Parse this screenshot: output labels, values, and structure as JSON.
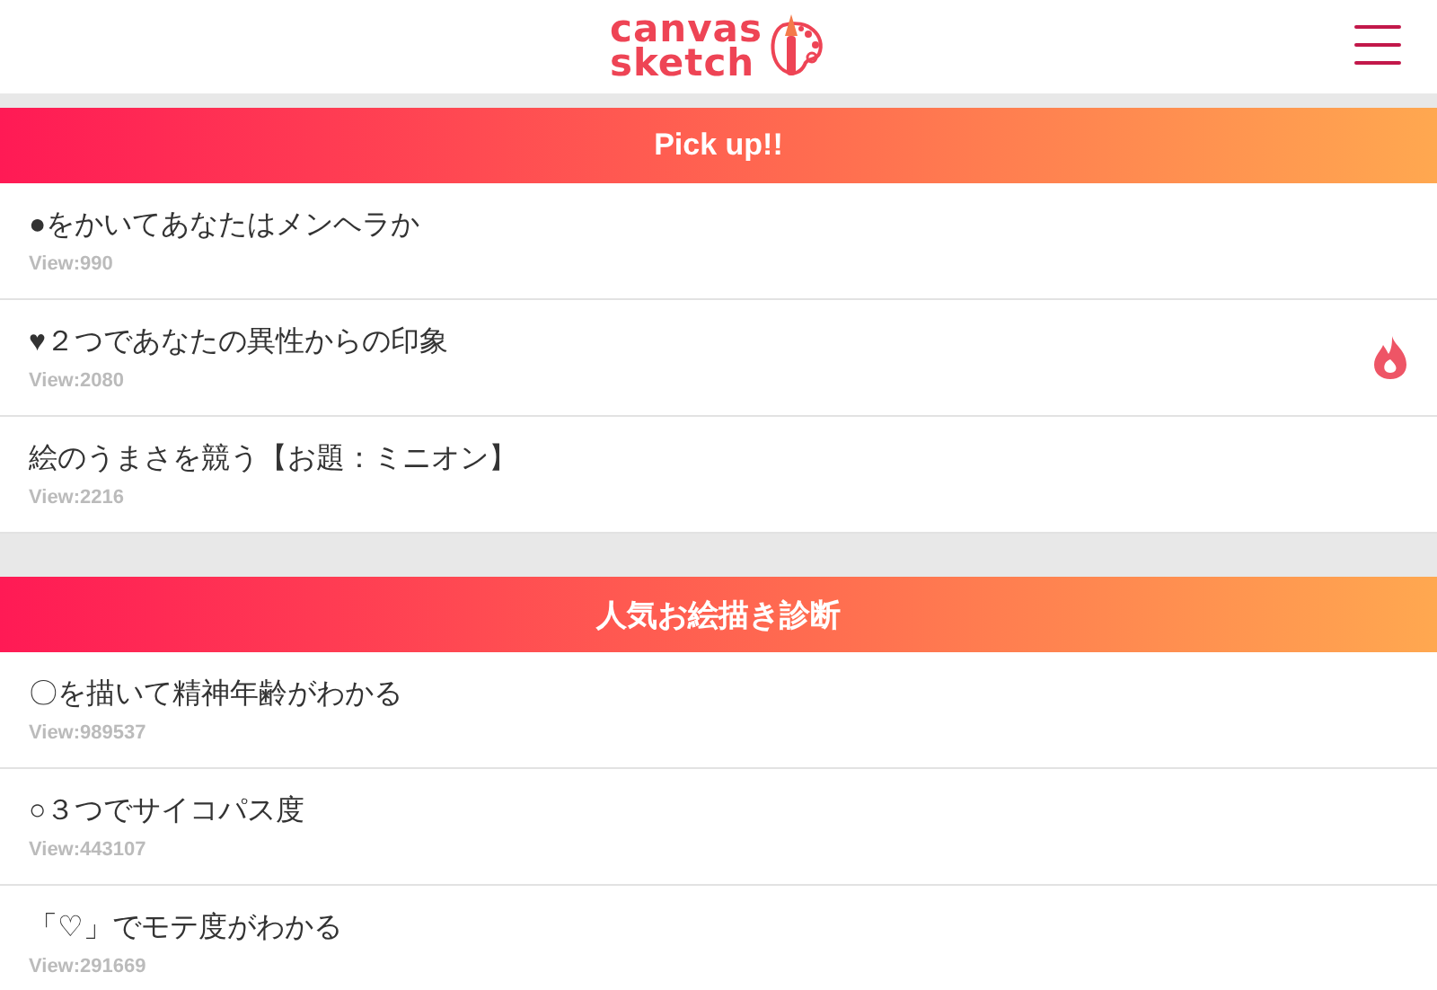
{
  "header": {
    "logo_line_1": "canvas",
    "logo_line_2": "sketch"
  },
  "sections": [
    {
      "title": "Pick up!!",
      "items": [
        {
          "title": "●をかいてあなたはメンヘラか",
          "views": "View:990",
          "hot": false
        },
        {
          "title": "♥２つであなたの異性からの印象",
          "views": "View:2080",
          "hot": true
        },
        {
          "title": "絵のうまさを競う【お題：ミニオン】",
          "views": "View:2216",
          "hot": false
        }
      ]
    },
    {
      "title": "人気お絵描き診断",
      "items": [
        {
          "title": "〇を描いて精神年齢がわかる",
          "views": "View:989537",
          "hot": false
        },
        {
          "title": "○３つでサイコパス度",
          "views": "View:443107",
          "hot": false
        },
        {
          "title": "「♡」でモテ度がわかる",
          "views": "View:291669",
          "hot": false
        }
      ]
    }
  ]
}
